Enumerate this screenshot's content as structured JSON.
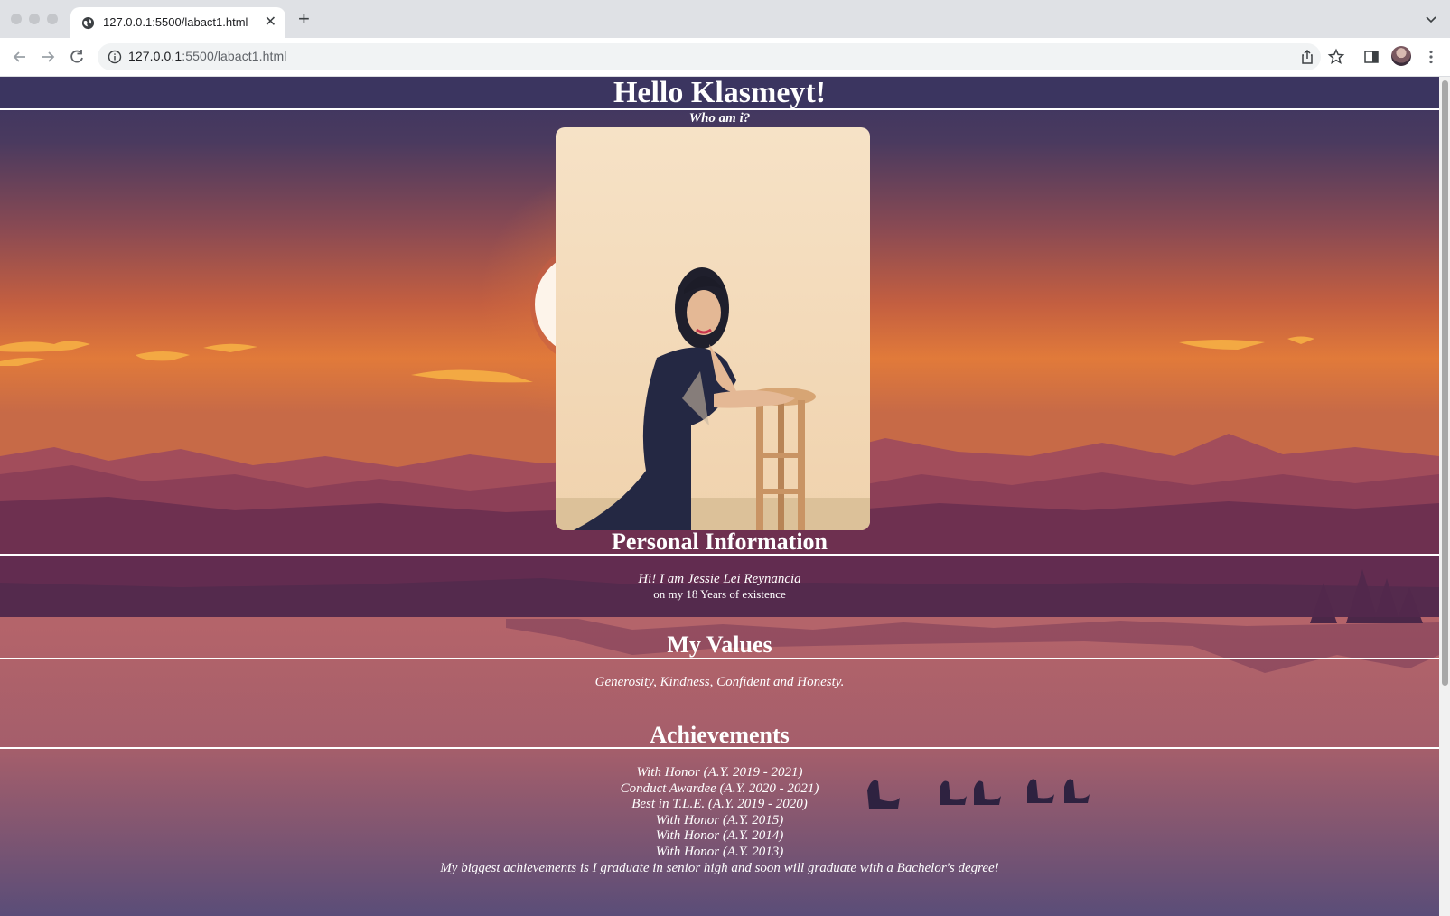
{
  "browser": {
    "tab_title": "127.0.0.1:5500/labact1.html",
    "url_host": "127.0.0.1",
    "url_rest": ":5500/labact1.html"
  },
  "page": {
    "title": "Hello Klasmeyt!",
    "subtitle": "Who am i?",
    "personal_heading": "Personal Information",
    "intro": "Hi! I am Jessie Lei Reynancia",
    "age_line": "on my 18 Years of existence",
    "values_heading": "My Values",
    "values_text": "Generosity, Kindness, Confident and Honesty.",
    "achievements_heading": "Achievements",
    "achievements": [
      "With Honor (A.Y. 2019 - 2021)",
      "Conduct Awardee (A.Y. 2020 - 2021)",
      "Best in T.L.E. (A.Y. 2019 - 2020)",
      "With Honor (A.Y. 2015)",
      "With Honor (A.Y. 2014)",
      "With Honor (A.Y. 2013)",
      "My biggest achievements is I graduate in senior high and soon will graduate with a Bachelor's degree!"
    ]
  },
  "colors": {
    "sky_top": "#3b3560",
    "sky_orange": "#e0773c",
    "mountain": "#8a3f58",
    "water": "#b86a6b",
    "text": "#ffffff"
  },
  "icons": [
    "globe-icon",
    "close-icon",
    "plus-icon",
    "chevron-down-icon",
    "back-arrow-icon",
    "forward-arrow-icon",
    "reload-icon",
    "info-icon",
    "share-icon",
    "star-icon",
    "side-panel-icon",
    "kebab-menu-icon"
  ]
}
